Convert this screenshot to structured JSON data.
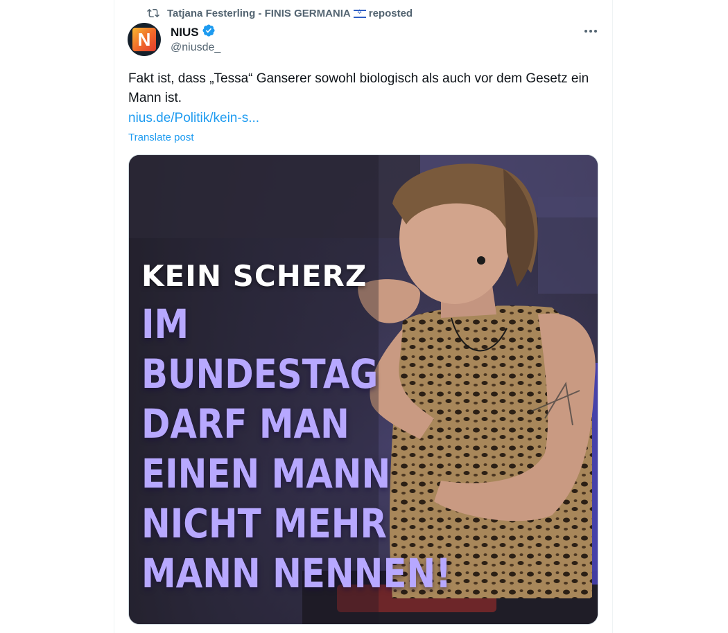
{
  "repost": {
    "icon": "repost-icon",
    "user": "Tatjana Festerling - FINIS GERMANIA",
    "flag": "israel-flag-icon",
    "label": "reposted"
  },
  "author": {
    "avatar_letter": "N",
    "name": "NIUS",
    "verified": true,
    "handle": "@niusde_"
  },
  "post": {
    "text": "Fakt ist, dass „Tessa“ Ganserer sowohl biologisch als auch vor dem Gesetz ein Mann ist.",
    "link": "nius.de/Politik/kein-s...",
    "translate_label": "Translate post"
  },
  "media": {
    "kicker": "KEIN SCHERZ",
    "headline_lines": [
      "IM",
      "BUNDESTAG",
      "DARF MAN",
      "EINEN MANN",
      "NICHT MEHR",
      "MANN NENNEN!"
    ]
  },
  "colors": {
    "link": "#1d9bf0",
    "secondary_text": "#536471",
    "headline": "#b7a8ff",
    "verified": "#1d9bf0"
  }
}
